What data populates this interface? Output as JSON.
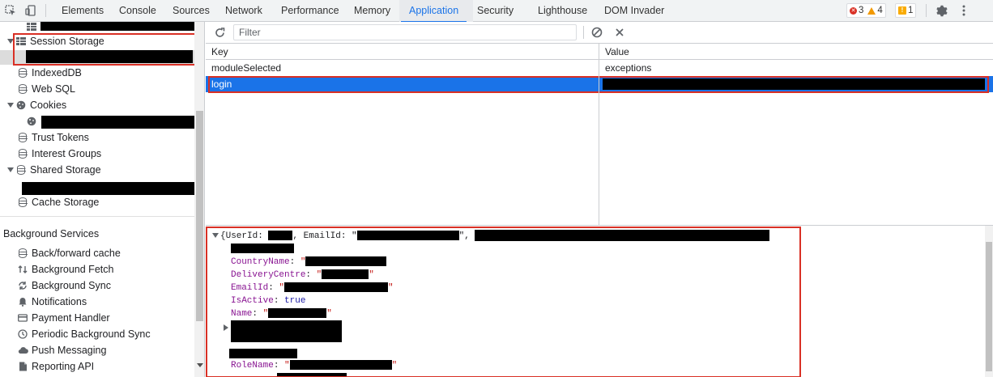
{
  "devtools": {
    "toolbar_icons": {
      "inspect": "inspect-icon",
      "device": "device-toggle-icon",
      "settings": "gear-icon",
      "more": "kebab-icon"
    },
    "tabs": [
      {
        "label": "Elements"
      },
      {
        "label": "Console"
      },
      {
        "label": "Sources"
      },
      {
        "label": "Network"
      },
      {
        "label": "Performance"
      },
      {
        "label": "Memory"
      },
      {
        "label": "Application",
        "active": true
      },
      {
        "label": "Security"
      },
      {
        "label": "Lighthouse"
      },
      {
        "label": "DOM Invader"
      }
    ],
    "badges": {
      "errors": "3",
      "warnings": "4",
      "issues": "1"
    }
  },
  "sidebar": {
    "storage_items": [
      {
        "label": "Session Storage",
        "icon": "grid-icon",
        "expanded": true
      },
      {
        "label": "IndexedDB",
        "icon": "database-icon"
      },
      {
        "label": "Web SQL",
        "icon": "database-icon"
      },
      {
        "label": "Cookies",
        "icon": "cookie-icon",
        "expanded": true
      },
      {
        "label": "Trust Tokens",
        "icon": "database-icon"
      },
      {
        "label": "Interest Groups",
        "icon": "database-icon"
      },
      {
        "label": "Shared Storage",
        "icon": "database-icon",
        "expanded": true
      },
      {
        "label": "Cache Storage",
        "icon": "database-icon"
      }
    ],
    "background_services_title": "Background Services",
    "background_services": [
      {
        "label": "Back/forward cache",
        "icon": "database-icon"
      },
      {
        "label": "Background Fetch",
        "icon": "arrows-updown-icon"
      },
      {
        "label": "Background Sync",
        "icon": "sync-icon"
      },
      {
        "label": "Notifications",
        "icon": "bell-icon"
      },
      {
        "label": "Payment Handler",
        "icon": "card-icon"
      },
      {
        "label": "Periodic Background Sync",
        "icon": "clock-icon"
      },
      {
        "label": "Push Messaging",
        "icon": "cloud-icon"
      },
      {
        "label": "Reporting API",
        "icon": "file-icon"
      }
    ]
  },
  "storage_view": {
    "filter_placeholder": "Filter",
    "columns": {
      "key": "Key",
      "value": "Value"
    },
    "rows": [
      {
        "key": "moduleSelected",
        "value": "exceptions"
      },
      {
        "key": "login",
        "value": "",
        "selected": true
      }
    ],
    "preview": {
      "line1_prefix": "{UserId: ",
      "line1_mid": ", EmailId: \"",
      "line1_end": "\", ",
      "fields": [
        {
          "key": "CountryName",
          "sep": ": ",
          "value": "\""
        },
        {
          "key": "DeliveryCentre",
          "sep": ": ",
          "value": "\""
        },
        {
          "key": "EmailId",
          "sep": ": ",
          "value": "\""
        },
        {
          "key": "IsActive",
          "sep": ": ",
          "value": "true"
        },
        {
          "key": "Name",
          "sep": ": ",
          "value": "\""
        }
      ],
      "role_key": "RoleName",
      "role_sep": ": ",
      "role_value": "\""
    }
  }
}
